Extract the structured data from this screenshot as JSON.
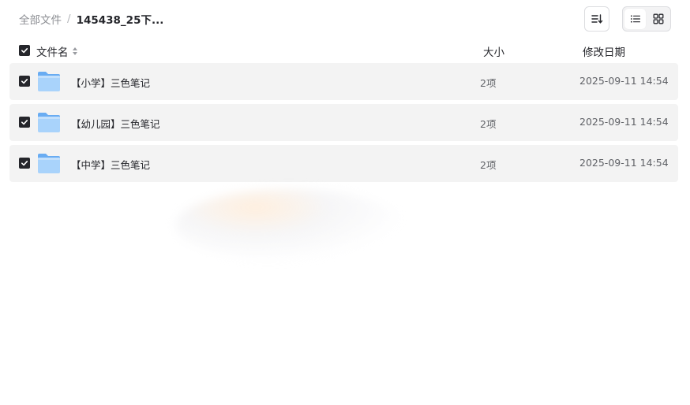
{
  "breadcrumb": {
    "root": "全部文件",
    "separator": "/",
    "current": "145438_25下..."
  },
  "toolbar": {
    "sort_icon": "sort-descending-icon",
    "view_modes": [
      {
        "name": "list-view-icon",
        "active": true
      },
      {
        "name": "grid-view-icon",
        "active": false
      }
    ]
  },
  "header": {
    "name": "文件名",
    "size": "大小",
    "date": "修改日期",
    "select_all_checked": true
  },
  "files": [
    {
      "name": "【小学】三色笔记",
      "size": "2项",
      "date": "2025-09-11 14:54",
      "checked": true,
      "icon": "folder-icon"
    },
    {
      "name": "【幼儿园】三色笔记",
      "size": "2项",
      "date": "2025-09-11 14:54",
      "checked": true,
      "icon": "folder-icon"
    },
    {
      "name": "【中学】三色笔记",
      "size": "2项",
      "date": "2025-09-11 14:54",
      "checked": true,
      "icon": "folder-icon"
    }
  ],
  "colors": {
    "checkbox": "#25262b",
    "row_background": "#f3f3f3",
    "folder_light": "#a9d3fb",
    "folder_dark": "#69acf2"
  }
}
